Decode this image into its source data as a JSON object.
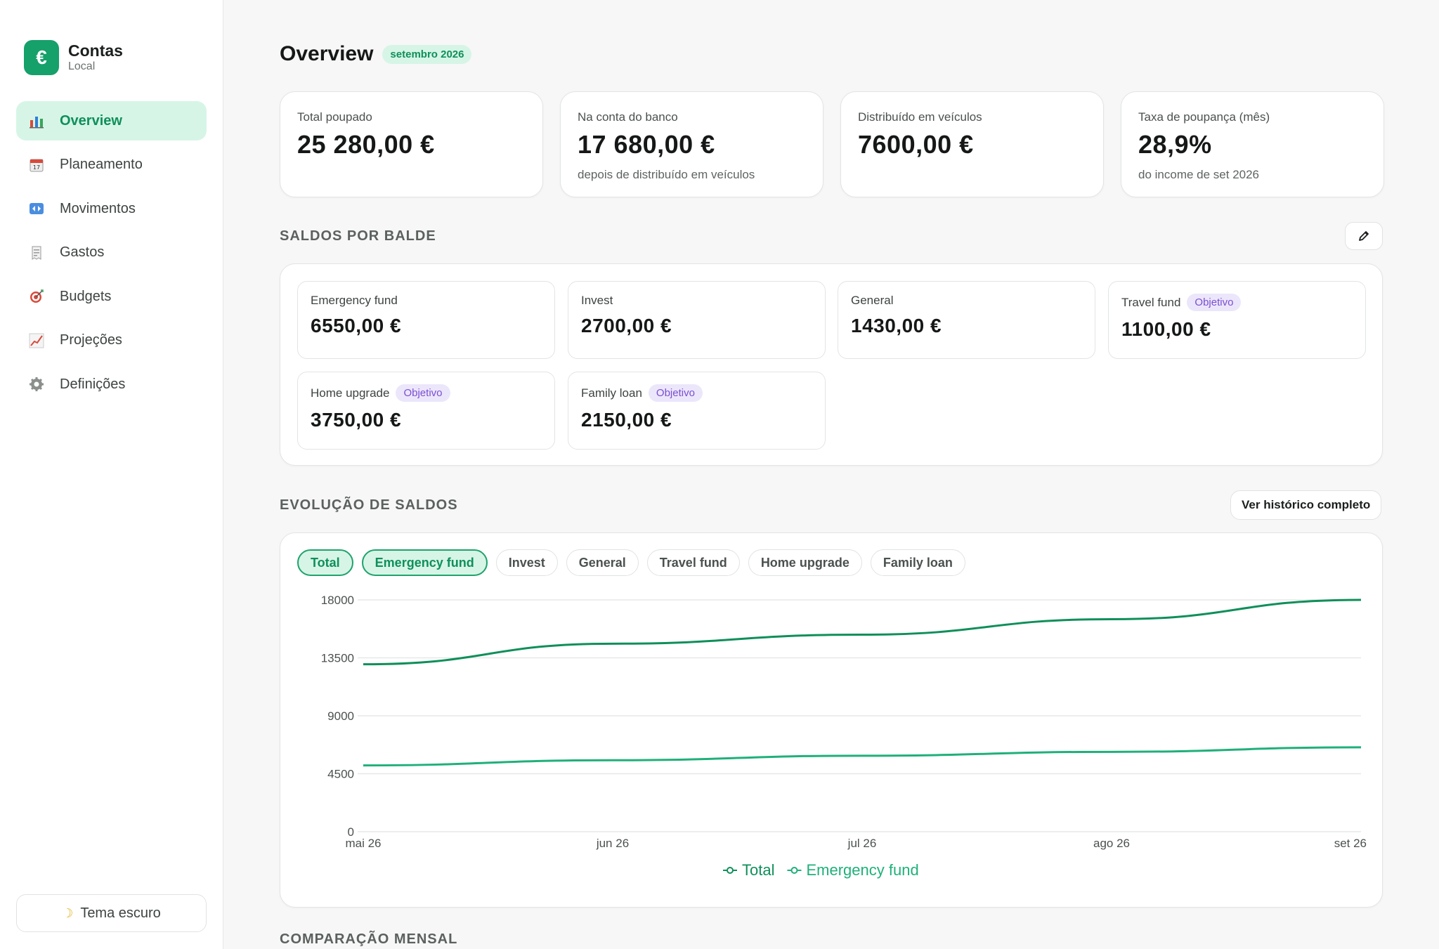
{
  "brand": {
    "logo_glyph": "€",
    "title": "Contas",
    "subtitle": "Local"
  },
  "nav": {
    "items": [
      {
        "label": "Overview",
        "icon": "bar-chart-icon",
        "active": true
      },
      {
        "label": "Planeamento",
        "icon": "calendar-icon",
        "active": false
      },
      {
        "label": "Movimentos",
        "icon": "arrows-icon",
        "active": false
      },
      {
        "label": "Gastos",
        "icon": "receipt-icon",
        "active": false
      },
      {
        "label": "Budgets",
        "icon": "target-icon",
        "active": false
      },
      {
        "label": "Projeções",
        "icon": "trend-icon",
        "active": false
      },
      {
        "label": "Definições",
        "icon": "gear-icon",
        "active": false
      }
    ],
    "theme_label": "Tema escuro"
  },
  "header": {
    "title": "Overview",
    "month": "setembro 2026"
  },
  "stats": [
    {
      "label": "Total poupado",
      "value": "25 280,00 €",
      "note": ""
    },
    {
      "label": "Na conta do banco",
      "value": "17 680,00 €",
      "note": "depois de distribuído em veículos"
    },
    {
      "label": "Distribuído em veículos",
      "value": "7600,00 €",
      "note": ""
    },
    {
      "label": "Taxa de poupança (mês)",
      "value": "28,9%",
      "note": "do income de set 2026"
    }
  ],
  "buckets_section": {
    "title": "SALDOS POR BALDE",
    "edit_icon": "pencil-icon",
    "goal_label": "Objetivo",
    "items": [
      {
        "name": "Emergency fund",
        "value": "6550,00 €",
        "goal": false
      },
      {
        "name": "Invest",
        "value": "2700,00 €",
        "goal": false
      },
      {
        "name": "General",
        "value": "1430,00 €",
        "goal": false
      },
      {
        "name": "Travel fund",
        "value": "1100,00 €",
        "goal": true
      },
      {
        "name": "Home upgrade",
        "value": "3750,00 €",
        "goal": true
      },
      {
        "name": "Family loan",
        "value": "2150,00 €",
        "goal": true
      }
    ]
  },
  "evolution": {
    "title": "EVOLUÇÃO DE SALDOS",
    "history_button": "Ver histórico completo",
    "chips": [
      {
        "label": "Total",
        "on": true
      },
      {
        "label": "Emergency fund",
        "on": true
      },
      {
        "label": "Invest",
        "on": false
      },
      {
        "label": "General",
        "on": false
      },
      {
        "label": "Travel fund",
        "on": false
      },
      {
        "label": "Home upgrade",
        "on": false
      },
      {
        "label": "Family loan",
        "on": false
      }
    ]
  },
  "chart_data": {
    "type": "line",
    "x": [
      "mai 26",
      "jun 26",
      "jul 26",
      "ago 26",
      "set 26"
    ],
    "yticks": [
      0,
      4500,
      9000,
      13500,
      18000
    ],
    "ylim": [
      0,
      18000
    ],
    "grid": true,
    "legend_position": "bottom-center",
    "series": [
      {
        "name": "Total",
        "color": "#0f8f5a",
        "values": [
          13000,
          14600,
          15300,
          16500,
          18000
        ]
      },
      {
        "name": "Emergency fund",
        "color": "#1fb07a",
        "values": [
          5150,
          5550,
          5900,
          6200,
          6550
        ]
      }
    ]
  },
  "bottom": {
    "title": "COMPARAÇÃO MENSAL"
  },
  "colors": {
    "accent": "#16a06a",
    "accent_light": "#d6f5e6",
    "goal": "#7a4fd1"
  }
}
